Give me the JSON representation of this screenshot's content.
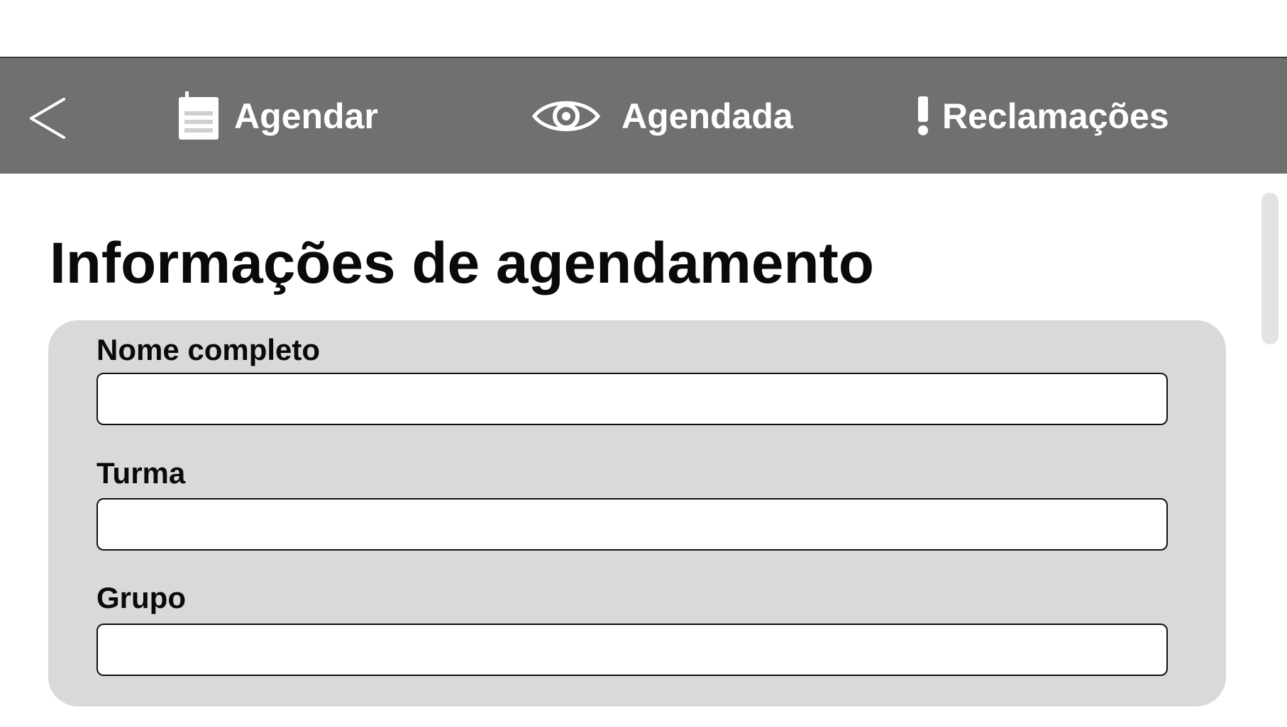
{
  "navbar": {
    "background_color": "#716f70",
    "back_icon": "chevron-left-icon",
    "items": [
      {
        "label": "Agendar",
        "icon": "calendar-icon"
      },
      {
        "label": "Agendada",
        "icon": "eye-icon"
      },
      {
        "label": "Reclamações",
        "icon": "exclamation-icon"
      }
    ]
  },
  "main": {
    "title": "Informações de agendamento",
    "form": {
      "card_color": "#d9d9d9",
      "fields": [
        {
          "label": "Nome completo",
          "value": "",
          "placeholder": ""
        },
        {
          "label": "Turma",
          "value": "",
          "placeholder": ""
        },
        {
          "label": "Grupo",
          "value": "",
          "placeholder": ""
        }
      ]
    }
  }
}
